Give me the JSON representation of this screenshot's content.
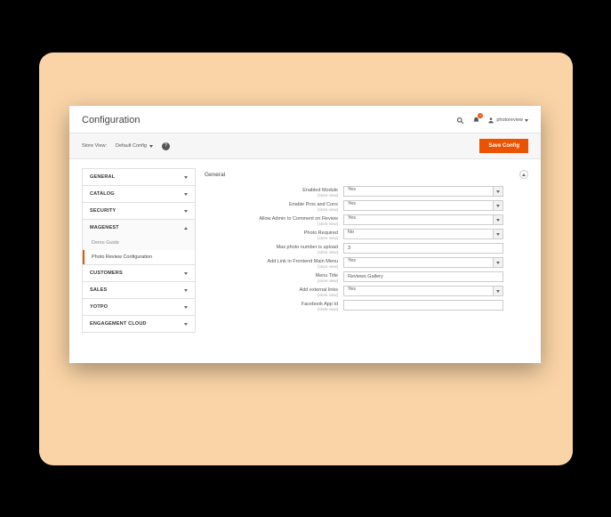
{
  "header": {
    "title": "Configuration",
    "username": "photoreview",
    "notification_count": "2"
  },
  "toolbar": {
    "store_view_label": "Store View:",
    "store_view_value": "Default Config",
    "save_label": "Save Config"
  },
  "sidebar": {
    "items": [
      {
        "label": "GENERAL"
      },
      {
        "label": "CATALOG"
      },
      {
        "label": "SECURITY"
      },
      {
        "label": "MAGENEST",
        "expanded": true,
        "children": [
          {
            "label": "Demo Guide"
          },
          {
            "label": "Photo Review Configuration",
            "active": true
          }
        ]
      },
      {
        "label": "CUSTOMERS"
      },
      {
        "label": "SALES"
      },
      {
        "label": "YOTPO"
      },
      {
        "label": "ENGAGEMENT CLOUD"
      }
    ]
  },
  "section": {
    "title": "General",
    "fields": [
      {
        "label": "Enabled Module",
        "scope": "[store view]",
        "type": "select",
        "value": "Yes"
      },
      {
        "label": "Enable Pros and Cons",
        "scope": "[store view]",
        "type": "select",
        "value": "Yes"
      },
      {
        "label": "Allow Admin to Comment on Review",
        "scope": "[store view]",
        "type": "select",
        "value": "Yes"
      },
      {
        "label": "Photo Required",
        "scope": "[store view]",
        "type": "select",
        "value": "No"
      },
      {
        "label": "Max photo number is upload",
        "scope": "[store view]",
        "type": "text",
        "value": "3"
      },
      {
        "label": "Add Link in Frontend Main Menu",
        "scope": "[store view]",
        "type": "select",
        "value": "Yes"
      },
      {
        "label": "Menu Title",
        "scope": "[store view]",
        "type": "text",
        "value": "Reviews Gallery"
      },
      {
        "label": "Add external links",
        "scope": "[store view]",
        "type": "select",
        "value": "Yes"
      },
      {
        "label": "Facebook App Id",
        "scope": "[store view]",
        "type": "text",
        "value": ""
      }
    ]
  },
  "colors": {
    "accent": "#eb5202"
  }
}
